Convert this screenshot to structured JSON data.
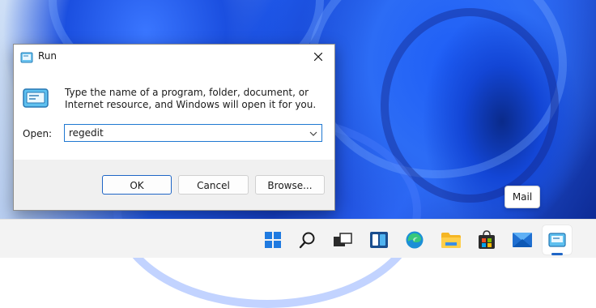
{
  "run_dialog": {
    "title": "Run",
    "message": "Type the name of a program, folder, document, or Internet resource, and Windows will open it for you.",
    "open_label": "Open:",
    "open_value": "regedit",
    "buttons": {
      "ok": "OK",
      "cancel": "Cancel",
      "browse": "Browse..."
    }
  },
  "tooltip": {
    "text": "Mail"
  },
  "taskbar": {
    "items": [
      {
        "name": "start",
        "icon": "windows-logo-icon"
      },
      {
        "name": "search",
        "icon": "search-icon"
      },
      {
        "name": "task-view",
        "icon": "task-view-icon"
      },
      {
        "name": "widgets",
        "icon": "widgets-icon"
      },
      {
        "name": "edge",
        "icon": "edge-icon"
      },
      {
        "name": "file-explorer",
        "icon": "folder-icon"
      },
      {
        "name": "store",
        "icon": "store-icon"
      },
      {
        "name": "mail",
        "icon": "mail-icon"
      },
      {
        "name": "run",
        "icon": "run-icon"
      }
    ]
  },
  "colors": {
    "accent": "#1f66c6",
    "taskbar_bg": "#f3f3f3",
    "dialog_button_area": "#f0f0f0"
  }
}
